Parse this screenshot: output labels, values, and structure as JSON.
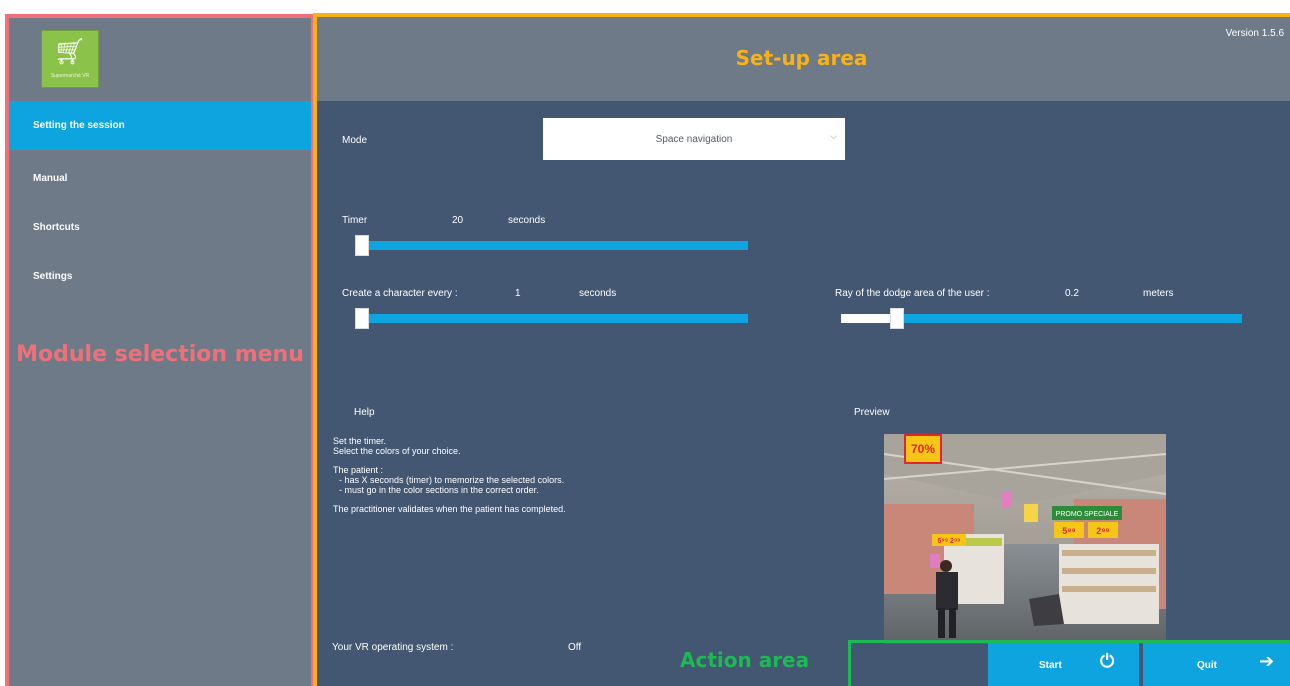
{
  "sidebar": {
    "logo_text": "Supermarché VR",
    "items": [
      {
        "label": "Setting the session",
        "active": true
      },
      {
        "label": "Manual",
        "active": false
      },
      {
        "label": "Shortcuts",
        "active": false
      },
      {
        "label": "Settings",
        "active": false
      }
    ]
  },
  "annotations": {
    "module": "Module selection menu",
    "setup": "Set-up area",
    "action": "Action area"
  },
  "header": {
    "version": "Version 1.5.6"
  },
  "setup": {
    "mode_label": "Mode",
    "mode_value": "Space navigation",
    "timer": {
      "label": "Timer",
      "value": "20",
      "unit": "seconds",
      "level": 0.0
    },
    "character": {
      "label": "Create a character every :",
      "value": "1",
      "unit": "seconds",
      "level": 0.0
    },
    "dodge": {
      "label": "Ray of the dodge area of the user :",
      "value": "0.2",
      "unit": "meters",
      "level": 0.14
    },
    "help_label": "Help",
    "help_lines": [
      "Set the timer.",
      "Select the colors of your choice.",
      "The patient :",
      "- has X seconds (timer) to memorize the selected colors.",
      "- must go in the color sections in the correct order.",
      "The practitioner validates when the patient has completed."
    ],
    "preview_label": "Preview",
    "preview_signs": {
      "promo_pct": "70%",
      "promo_text": "PROMO SPECIALE",
      "price_a": "5⁹⁹",
      "price_b": "2⁹⁹",
      "price_c": "5⁹⁹ 2⁹⁹"
    },
    "vr_label": "Your VR operating system :",
    "vr_value": "Off"
  },
  "actions": {
    "start_label": "Start",
    "quit_label": "Quit"
  },
  "colors": {
    "accent": "#0ea4e0",
    "panel": "#445772",
    "sidebar": "#6e7a87",
    "frame_module": "#f07079",
    "frame_setup": "#f7b21a",
    "frame_action": "#1db954"
  }
}
